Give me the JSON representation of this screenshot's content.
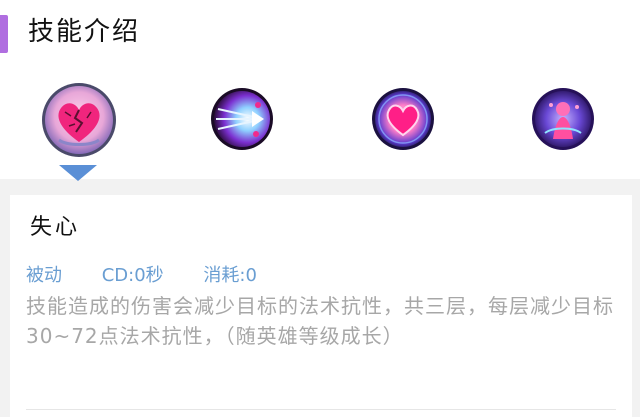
{
  "header": {
    "title": "技能介绍",
    "accent_color": "#b06ee0"
  },
  "skills_bar": {
    "selected_index": 0,
    "icons": [
      {
        "name": "broken-heart-icon"
      },
      {
        "name": "light-dash-icon"
      },
      {
        "name": "glowing-heart-icon"
      },
      {
        "name": "hero-portrait-icon"
      }
    ],
    "pointer_color": "#5a8fd6"
  },
  "skill_detail": {
    "name": "失心",
    "type": "被动",
    "cooldown": "CD:0秒",
    "cost": "消耗:0",
    "description": "技能造成的伤害会减少目标的法术抗性，共三层，每层减少目标30~72点法术抗性，（随英雄等级成长）",
    "meta_color": "#6a9ed2",
    "desc_color": "#a7a7a7"
  }
}
